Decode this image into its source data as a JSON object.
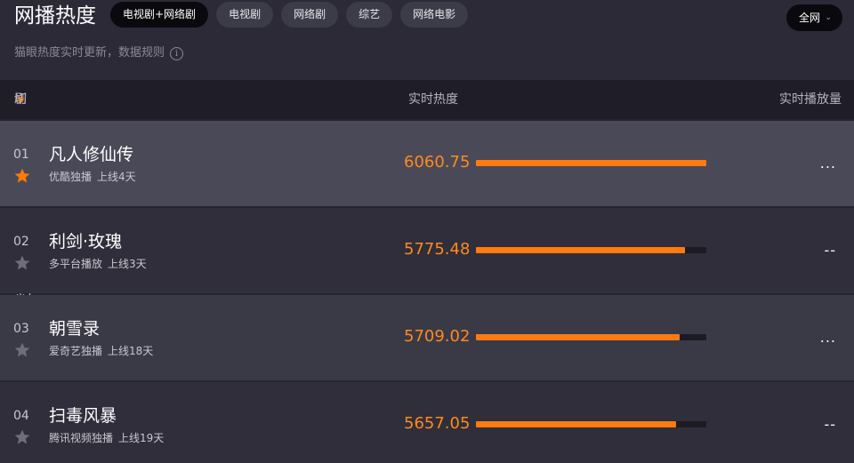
{
  "header": {
    "title": "网播热度",
    "tabs": [
      {
        "label": "电视剧+网络剧",
        "active": true
      },
      {
        "label": "电视剧",
        "active": false
      },
      {
        "label": "网络剧",
        "active": false
      },
      {
        "label": "综艺",
        "active": false
      },
      {
        "label": "网络电影",
        "active": false
      }
    ],
    "scope": {
      "label": "全网",
      "icon": "chevron-down-icon"
    },
    "subtitle": "猫眼热度实时更新，数据规则",
    "info_icon": "info-circle-icon"
  },
  "columns": {
    "name_prefix": "剧集(点击",
    "name_suffix": "切换右侧展示)",
    "heat": "实时热度",
    "plays": "实时播放量"
  },
  "colors": {
    "accent": "#ff7a10",
    "star_active": "#ff7a00",
    "star_inactive": "#6e6d7a"
  },
  "heat_scale_max": 6060.75,
  "rows": [
    {
      "rank": "01",
      "title": "凡人修仙传",
      "platform": "优酷独播",
      "online": "上线4天",
      "heat": "6060.75",
      "heat_value": 6060.75,
      "plays": "...",
      "starred": true
    },
    {
      "rank": "02",
      "title": "利剑·玫瑰",
      "platform": "多平台播放",
      "online": "上线3天",
      "heat": "5775.48",
      "heat_value": 5775.48,
      "plays": "--",
      "starred": false
    },
    {
      "rank": "03",
      "title": "朝雪录",
      "platform": "爱奇艺独播",
      "online": "上线18天",
      "heat": "5709.02",
      "heat_value": 5709.02,
      "plays": "...",
      "starred": false
    },
    {
      "rank": "04",
      "title": "扫毒风暴",
      "platform": "腾讯视频独播",
      "online": "上线19天",
      "heat": "5657.05",
      "heat_value": 5657.05,
      "plays": "--",
      "starred": false
    }
  ]
}
